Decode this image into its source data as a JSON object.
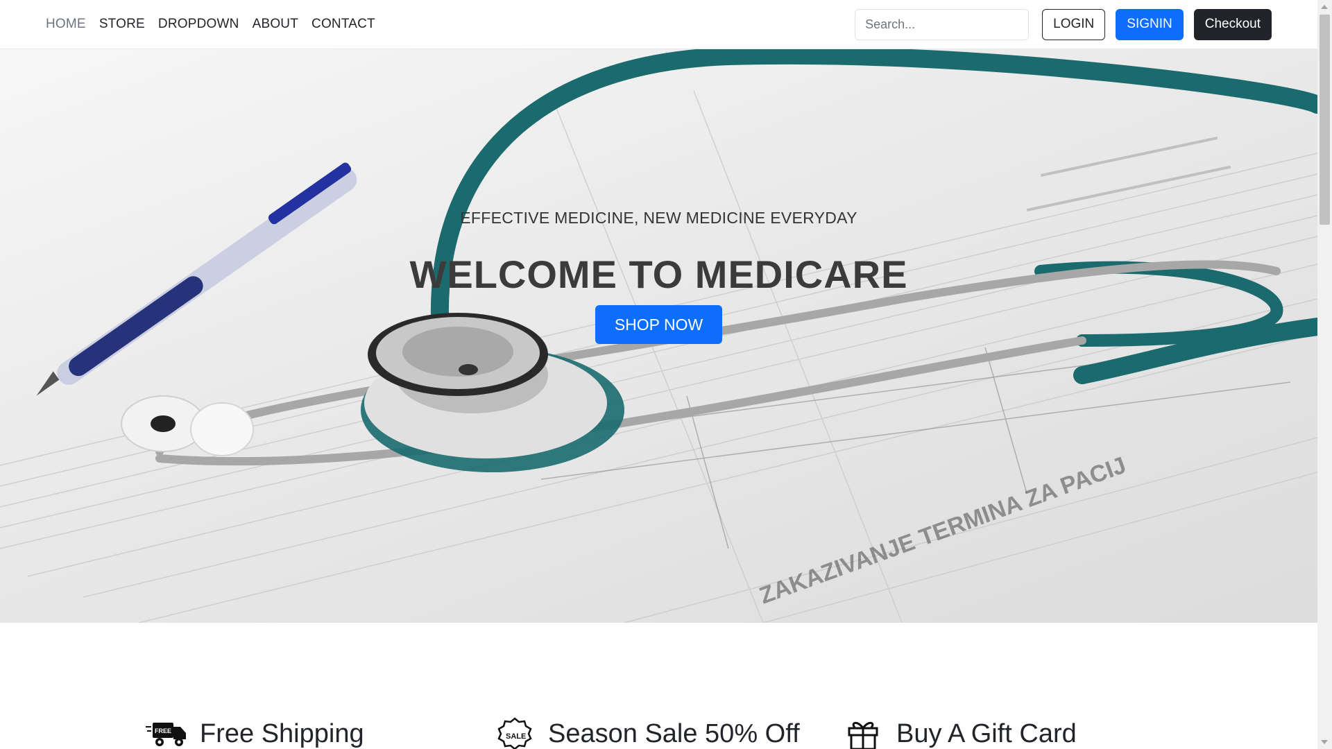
{
  "nav": {
    "links": [
      {
        "label": "HOME"
      },
      {
        "label": "STORE"
      },
      {
        "label": "DROPDOWN"
      },
      {
        "label": "ABOUT"
      },
      {
        "label": "CONTACT"
      }
    ],
    "search_placeholder": "Search...",
    "login_label": "LOGIN",
    "signin_label": "SIGNIN",
    "checkout_label": "Checkout"
  },
  "hero": {
    "subtitle": "EFFECTIVE MEDICINE, NEW MEDICINE EVERYDAY",
    "title": "WELCOME TO MEDICARE",
    "cta_label": "SHOP NOW",
    "background": "stethoscope-on-medical-form-photo"
  },
  "features": [
    {
      "icon": "free-shipping-truck-icon",
      "label": "Free Shipping"
    },
    {
      "icon": "sale-badge-icon",
      "label": "Season Sale 50% Off"
    },
    {
      "icon": "gift-icon",
      "label": "Buy A Gift Card"
    }
  ],
  "colors": {
    "primary": "#0d6efd",
    "dark": "#212529",
    "active_link": "#6c757d"
  }
}
